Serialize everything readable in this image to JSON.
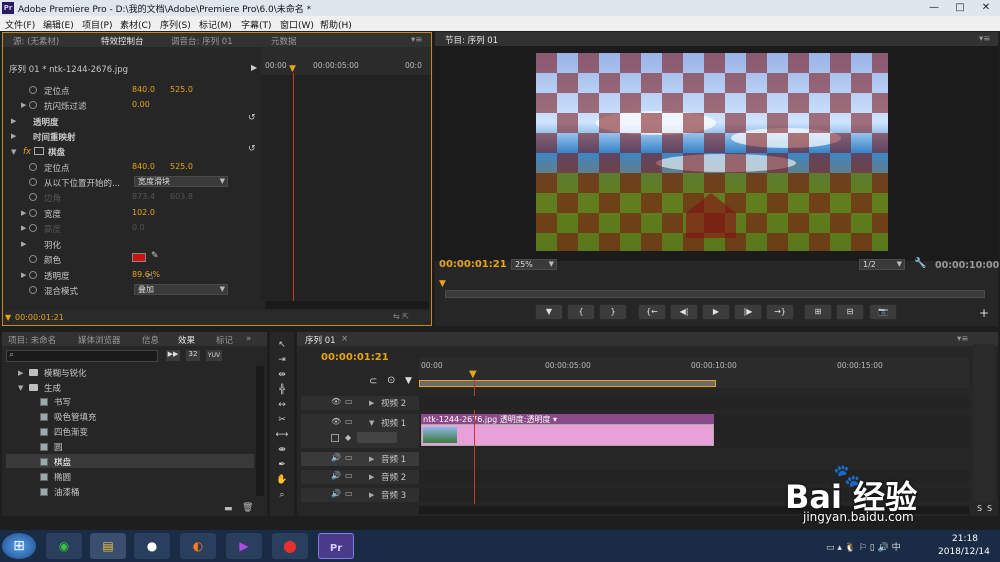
{
  "window": {
    "app_icon": "Pr",
    "title": "Adobe Premiere Pro - D:\\我的文档\\Adobe\\Premiere Pro\\6.0\\未命名 *",
    "minimize": "—",
    "maximize": "□",
    "close": "✕"
  },
  "menu": [
    "文件(F)",
    "编辑(E)",
    "项目(P)",
    "素材(C)",
    "序列(S)",
    "标记(M)",
    "字幕(T)",
    "窗口(W)",
    "帮助(H)"
  ],
  "effect_controls": {
    "tabs": [
      "源: (无素材)",
      "特效控制台",
      "调音台: 序列 01",
      "元数据"
    ],
    "header": "序列 01 * ntk-1244-2676.jpg",
    "ruler": {
      "t0": "00:00",
      "t1": "00:00:05:00",
      "t2": "00:0"
    },
    "rows": [
      {
        "label": "定位点",
        "v1": "840.0",
        "v2": "525.0"
      },
      {
        "label": "抗闪烁过滤",
        "v1": "0.00"
      },
      {
        "label": "透明度"
      },
      {
        "label": "时间重映射"
      },
      {
        "label": "棋盘"
      },
      {
        "label": "定位点",
        "v1": "840.0",
        "v2": "525.0"
      },
      {
        "label": "从以下位置开始的...",
        "dropdown": "宽度滑块"
      },
      {
        "label": "边角",
        "v1": "873.4",
        "v2": "603.8"
      },
      {
        "label": "宽度",
        "v1": "102.0"
      },
      {
        "label": "高度",
        "v1": "0.0"
      },
      {
        "label": "羽化"
      },
      {
        "label": "颜色"
      },
      {
        "label": "透明度",
        "v1": "89.6 %"
      },
      {
        "label": "混合模式",
        "dropdown": "叠加"
      }
    ],
    "fx_label": "fx",
    "timecode": "00:00:01:21"
  },
  "program": {
    "tab": "节目: 序列 01",
    "timecode": "00:00:01:21",
    "zoom": "25%",
    "resolution": "1/2",
    "duration": "00:00:10:00",
    "transport": [
      "▼",
      "{",
      "}",
      "{←",
      "◀|",
      "▶",
      "|▶",
      "→}",
      "⊞",
      "⊟",
      "📷"
    ],
    "add": "+"
  },
  "project": {
    "tabs": [
      "项目: 未命名",
      "媒体浏览器",
      "信息",
      "效果",
      "标记"
    ],
    "search_placeholder": "",
    "badges": [
      "32",
      "YUV"
    ],
    "tree": [
      {
        "label": "模糊与锐化",
        "type": "folder"
      },
      {
        "label": "生成",
        "type": "folder"
      },
      {
        "label": "书写",
        "type": "file"
      },
      {
        "label": "吸色管填充",
        "type": "file"
      },
      {
        "label": "四色渐变",
        "type": "file"
      },
      {
        "label": "圆",
        "type": "file"
      },
      {
        "label": "棋盘",
        "type": "file"
      },
      {
        "label": "椭圆",
        "type": "file"
      },
      {
        "label": "油漆桶",
        "type": "file"
      }
    ]
  },
  "timeline": {
    "tab": "序列 01",
    "timecode": "00:00:01:21",
    "ruler": [
      "00:00",
      "00:00:05:00",
      "00:00:10:00",
      "00:00:15:00"
    ],
    "tracks": [
      {
        "name": "视频 2"
      },
      {
        "name": "视频 1"
      },
      {
        "name": "音频 1"
      },
      {
        "name": "音频 2"
      },
      {
        "name": "音频 3"
      }
    ],
    "clip_label": "ntk-1244-2676.jpg 透明度:透明度 ▾",
    "ss": [
      "S",
      "S"
    ]
  },
  "watermark": {
    "brand": "Bai 经验",
    "url": "jingyan.baidu.com"
  },
  "taskbar": {
    "time": "21:18",
    "date": "2018/12/14"
  },
  "colors": {
    "accent": "#e8a419",
    "playhead": "#c0392b",
    "clip_pink": "#e8a0d8",
    "clip_header": "#8a4a8a",
    "swatch": "#cc1111"
  }
}
